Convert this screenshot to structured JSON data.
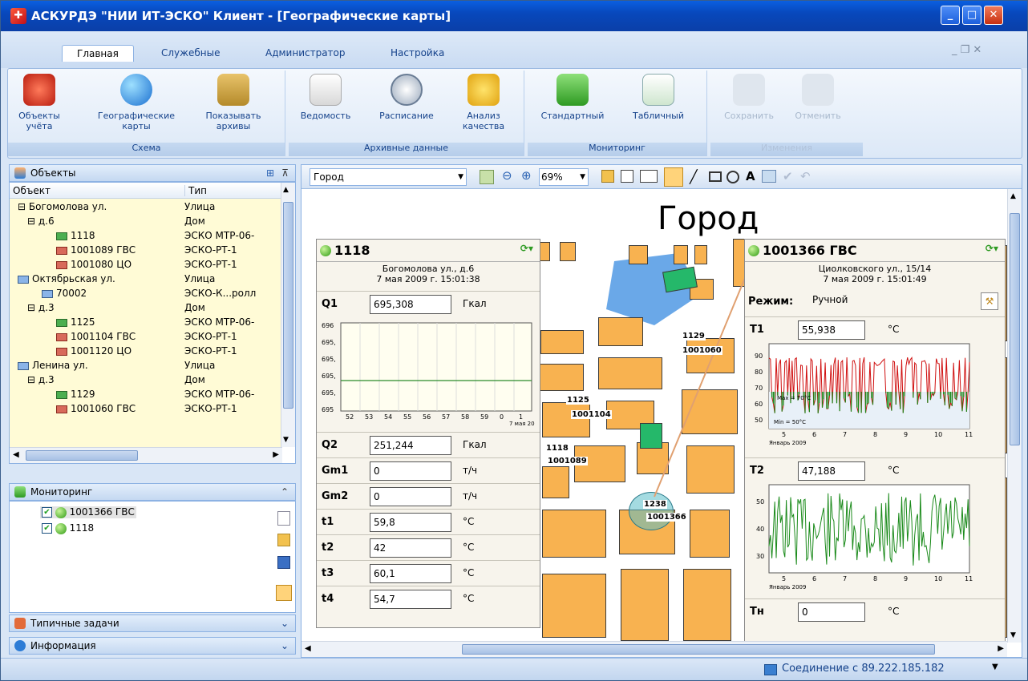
{
  "window": {
    "title": "АСКУРДЭ \"НИИ ИТ-ЭСКО\" Клиент - [Географические карты]"
  },
  "ribbon": {
    "tabs": [
      "Главная",
      "Служебные",
      "Администратор",
      "Настройка"
    ],
    "groups": [
      {
        "label": "Схема",
        "buttons": [
          "Объекты учёта",
          "Географические карты",
          "Показывать архивы"
        ]
      },
      {
        "label": "Архивные данные",
        "buttons": [
          "Ведомость",
          "Расписание",
          "Анализ качества"
        ]
      },
      {
        "label": "Мониторинг",
        "buttons": [
          "Стандартный",
          "Табличный"
        ]
      },
      {
        "label": "Изменения",
        "buttons": [
          "Сохранить",
          "Отменить"
        ]
      }
    ]
  },
  "objects": {
    "title": "Объекты",
    "col_object": "Объект",
    "col_type": "Тип",
    "rows": [
      {
        "name": "Богомолова ул.",
        "type": "Улица"
      },
      {
        "name": "д.6",
        "type": "Дом"
      },
      {
        "name": "1118",
        "type": "ЭСКО МТР-06-"
      },
      {
        "name": "1001089 ГВС",
        "type": "ЭСКО-РТ-1"
      },
      {
        "name": "1001080 ЦО",
        "type": "ЭСКО-РТ-1"
      },
      {
        "name": "Октябрьская ул.",
        "type": "Улица"
      },
      {
        "name": "70002",
        "type": "ЭСКО-К...ролл"
      },
      {
        "name": "д.3",
        "type": "Дом"
      },
      {
        "name": "1125",
        "type": "ЭСКО МТР-06-"
      },
      {
        "name": "1001104 ГВС",
        "type": "ЭСКО-РТ-1"
      },
      {
        "name": "1001120 ЦО",
        "type": "ЭСКО-РТ-1"
      },
      {
        "name": "Ленина ул.",
        "type": "Улица"
      },
      {
        "name": "д.3",
        "type": "Дом"
      },
      {
        "name": "1129",
        "type": "ЭСКО МТР-06-"
      },
      {
        "name": "1001060 ГВС",
        "type": "ЭСКО-РТ-1"
      }
    ]
  },
  "monitoring": {
    "title": "Мониторинг",
    "items": [
      "1001366 ГВС",
      "1118"
    ]
  },
  "typical": {
    "title": "Типичные задачи"
  },
  "info": {
    "title": "Информация"
  },
  "map": {
    "layer": "Город",
    "zoom": "69%",
    "title": "Город",
    "markers": [
      "1129",
      "1001060",
      "1125",
      "1001104",
      "1118",
      "1001089",
      "1238",
      "1001366"
    ]
  },
  "panel1118": {
    "title": "1118",
    "address": "Богомолова ул., д.6",
    "datetime": "7 мая 2009 г. 15:01:38",
    "rows": [
      {
        "k": "Q1",
        "v": "695,308",
        "u": "Гкал"
      },
      {
        "k": "Q2",
        "v": "251,244",
        "u": "Гкал"
      },
      {
        "k": "Gm1",
        "v": "0",
        "u": "т/ч"
      },
      {
        "k": "Gm2",
        "v": "0",
        "u": "т/ч"
      },
      {
        "k": "t1",
        "v": "59,8",
        "u": "°C"
      },
      {
        "k": "t2",
        "v": "42",
        "u": "°C"
      },
      {
        "k": "t3",
        "v": "60,1",
        "u": "°C"
      },
      {
        "k": "t4",
        "v": "54,7",
        "u": "°C"
      }
    ],
    "chart_y_ticks": [
      "696",
      "695,",
      "695,",
      "695,",
      "695,",
      "695"
    ],
    "chart_x_ticks": [
      "52",
      "53",
      "54",
      "55",
      "56",
      "57",
      "58",
      "59",
      "0",
      "1"
    ],
    "chart_x_caption": "7 мая 20"
  },
  "panel1001366": {
    "title": "1001366 ГВС",
    "address": "Циолковского ул., 15/14",
    "datetime": "7 мая 2009 г. 15:01:49",
    "mode_label": "Режим:",
    "mode_value": "Ручной",
    "rows": [
      {
        "k": "T1",
        "v": "55,938",
        "u": "°C"
      },
      {
        "k": "T2",
        "v": "47,188",
        "u": "°C"
      },
      {
        "k": "Тн",
        "v": "0",
        "u": "°C"
      }
    ],
    "t1_y_ticks": [
      "90",
      "80",
      "70",
      "60",
      "50"
    ],
    "t1_max": "Max = 70°C",
    "t1_min": "Min = 50°C",
    "t2_y_ticks": [
      "50",
      "40",
      "30"
    ],
    "x_ticks": [
      "5",
      "6",
      "7",
      "8",
      "9",
      "10",
      "11"
    ],
    "x_caption": "Январь 2009"
  },
  "status": {
    "connection": "Соединение с 89.222.185.182"
  }
}
